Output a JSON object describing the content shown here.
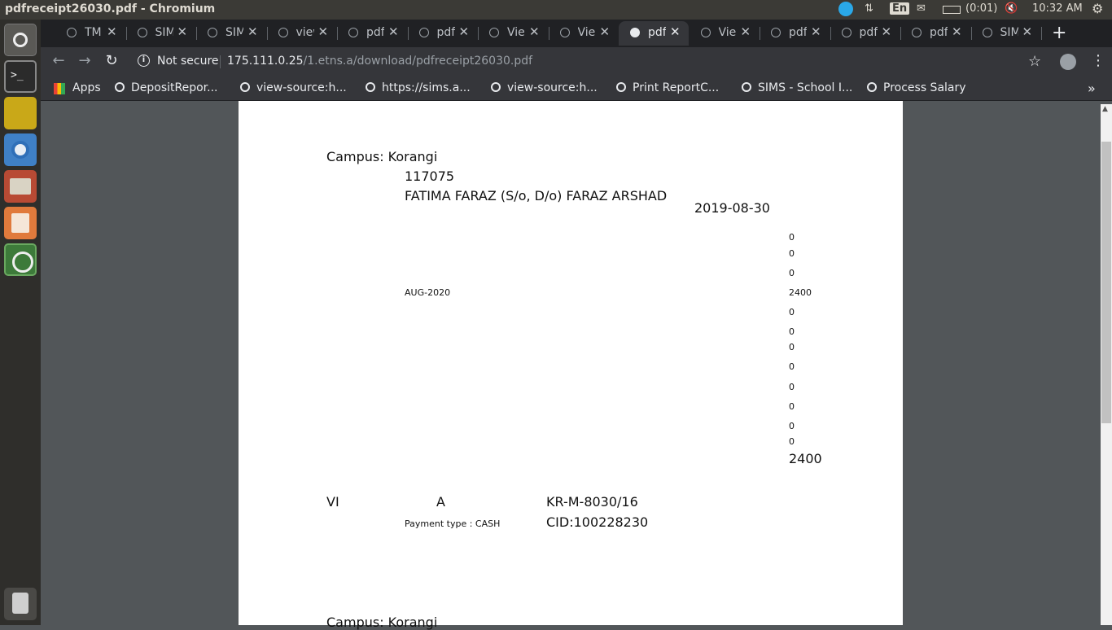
{
  "window": {
    "title": "pdfreceipt26030.pdf - Chromium"
  },
  "tray": {
    "lang": "En",
    "battery": "(0:01)",
    "time": "10:32 AM"
  },
  "tabs": [
    {
      "label": "TM"
    },
    {
      "label": "SIM"
    },
    {
      "label": "SIM"
    },
    {
      "label": "view"
    },
    {
      "label": "pdf"
    },
    {
      "label": "pdf"
    },
    {
      "label": "Vie"
    },
    {
      "label": "Vie"
    },
    {
      "label": "pdf",
      "active": true
    },
    {
      "label": "Vie"
    },
    {
      "label": "pdf"
    },
    {
      "label": "pdf"
    },
    {
      "label": "pdf"
    },
    {
      "label": "SIM"
    }
  ],
  "address": {
    "security": "Not secure",
    "host": "175.111.0.25",
    "path": "/1.etns.a/download/pdfreceipt26030.pdf"
  },
  "bookmarks": [
    {
      "label": "Apps"
    },
    {
      "label": "DepositRepor..."
    },
    {
      "label": "view-source:h..."
    },
    {
      "label": "https://sims.a..."
    },
    {
      "label": "view-source:h..."
    },
    {
      "label": "Print ReportC..."
    },
    {
      "label": "SIMS - School I..."
    },
    {
      "label": "Process Salary"
    }
  ],
  "receipt": {
    "campus": "Campus: Korangi",
    "student_id": "117075",
    "student_name": "FATIMA FARAZ (S/o, D/o) FARAZ ARSHAD",
    "date": "2019-08-30",
    "month": "AUG-2020",
    "amounts": [
      "0",
      "0",
      "0",
      "2400",
      "0",
      "0",
      "0",
      "0",
      "0",
      "0",
      "0",
      "0"
    ],
    "total": "2400",
    "class": "VI",
    "section": "A",
    "reg_no": "KR-M-8030/16",
    "payment_type": "Payment type : CASH",
    "cid": "CID:100228230",
    "next_campus": "Campus: Korangi"
  }
}
